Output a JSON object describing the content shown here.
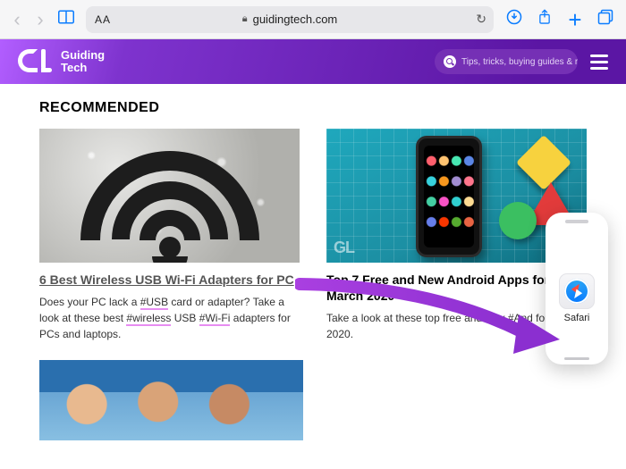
{
  "chrome": {
    "url": "guidingtech.com",
    "aa": "AA"
  },
  "site": {
    "brand_line1": "Guiding",
    "brand_line2": "Tech",
    "search_placeholder": "Tips, tricks, buying guides & r",
    "watermark": "GL"
  },
  "content": {
    "section_title": "RECOMMENDED",
    "cards": [
      {
        "title": "6 Best Wireless USB Wi-Fi Adapters for PC",
        "desc_pre": "Does your PC lack a ",
        "ht1": "#USB",
        "desc_mid": " card or adapter? Take a look at these best ",
        "ht2": "#wireless",
        "desc_mid2": " USB ",
        "ht3": "#Wi-Fi",
        "desc_post": " adapters for PCs and laptops."
      },
      {
        "title": "Top 7 Free and New Android Apps for March 2020",
        "desc_pre": "Take a look at these top free and new ",
        "ht1": "#And",
        "desc_post": " for March 2020."
      }
    ]
  },
  "slideover": {
    "app_label": "Safari"
  }
}
